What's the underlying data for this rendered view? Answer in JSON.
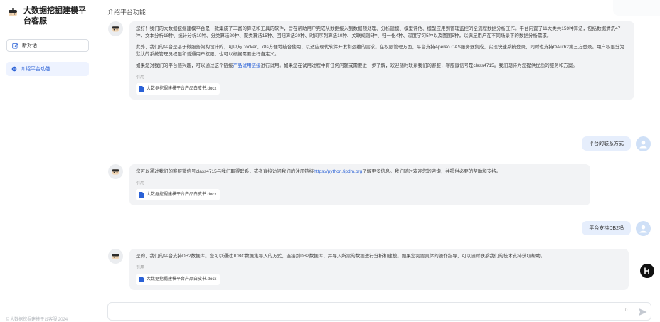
{
  "sidebar": {
    "brand_title": "大数据挖掘建模平台客服",
    "new_chat_label": "新对话",
    "conversations": [
      {
        "label": "介绍平台功能",
        "active": true
      }
    ],
    "copyright": "© 大数据挖掘建模平台客服 2024"
  },
  "header": {
    "title": "介绍平台功能"
  },
  "messages": [
    {
      "role": "bot",
      "paragraphs": [
        "您好！我们的大数据挖掘建模平台是一款集成了丰富的算法和工具的软件，旨在帮助用户完成从数据接入到数据预处理、分析建模、模型评估、模型应用到管理监控的全流程数据分析工作。平台内置了11大类共159种算法，包括数据清洗47种、文本分析18种、统计分析10种、分类算法20种、聚类算法15种、回归算法20种、时间序列算法10种、关联规则5种、归一化4种、深度学习5种以及图图5种，以满足用户在不同场景下的数据分析需求。",
        "此外，我们的平台是基于微服务架构设计的，可以与Docker、k8s方便地结合使用，以适应现代软件开发和运维的需求。在权限管理方面，平台支持Apereo CAS服务器集成，实现快速系统登录，同时也支持OAuth2第三方登录。用户权限分为默认的系统管理员权限和普通用户权限，也可以根据需要进行自定义。"
      ],
      "p3_before": "如果您对我们的平台感兴趣，可以通过这个链接",
      "p3_link": "产品试用链接",
      "p3_after": "进行试用。如果您在试用过程中有任何问题或需要进一步了解，欢迎随时联系我们的客服，客服微信号是class4715。我们期待为您提供优质的服务和方案。",
      "cite_label": "引用",
      "cite_file": "大数据挖掘建模平台产品白皮书.docx"
    },
    {
      "role": "user",
      "text": "平台的联系方式"
    },
    {
      "role": "bot",
      "p_before": "您可以通过我们的客服微信号class4715与我们取得联系，或者直接访问我们的注册链接",
      "p_link": "https://python.tipdm.org",
      "p_after": "了解更多信息。我们随时欢迎您的咨询，并提供必要的帮助和支持。",
      "cite_label": "引用",
      "cite_file": "大数据挖掘建模平台产品白皮书.docx"
    },
    {
      "role": "user",
      "text": "平台支持DB2吗"
    },
    {
      "role": "bot",
      "text": "是的，我们的平台支持DB2数据库。您可以通过JDBC数据集导入的方式，连接到DB2数据库，并导入所需的数据进行分析和建模。如果您需要具体的操作指导，可以随时联系我们的技术支持获取帮助。",
      "cite_label": "引用",
      "cite_file": "大数据挖掘建模平台产品白皮书.docx"
    }
  ],
  "input": {
    "value": "",
    "placeholder": "",
    "counter": "0"
  },
  "icons": {
    "brand": "robot-logo-icon",
    "new_chat": "edit-icon",
    "conversation": "chat-bubble-icon",
    "file": "document-icon",
    "send": "send-icon",
    "float": "assistant-icon"
  },
  "colors": {
    "accent": "#2a61d6",
    "bot_bubble": "#f2f3f5",
    "user_bubble": "#e6eefc",
    "active_item": "#eef3ff"
  }
}
